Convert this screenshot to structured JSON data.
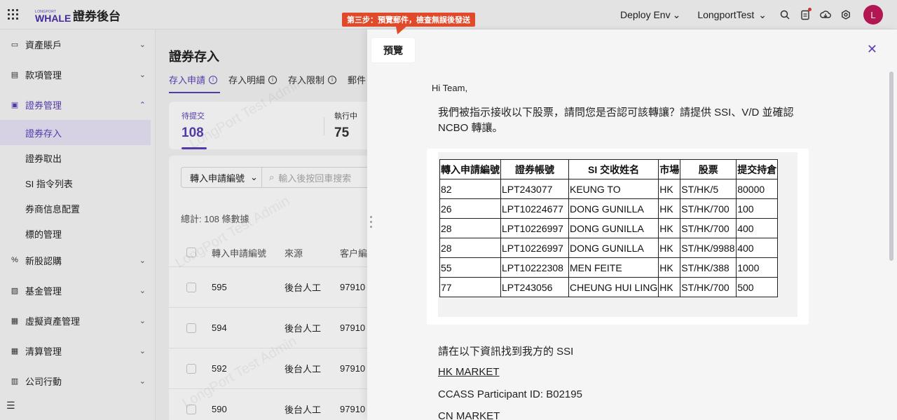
{
  "app": {
    "brand_small": "LONGPORT",
    "brand": "WHALE",
    "title": "證券後台",
    "env_label": "Deploy Env",
    "account_label": "LongportTest",
    "avatar_initial": "L",
    "icons": [
      "apps-grid-icon",
      "search-icon",
      "task-icon",
      "download-icon",
      "settings-icon",
      "chevron-down-icon"
    ]
  },
  "annotation": {
    "text": "第三步：預覽郵件，檢查無誤後發送",
    "color": "#e04a2a"
  },
  "sidebar": {
    "items": [
      {
        "label": "資產賬戶",
        "icon": "wallet-icon"
      },
      {
        "label": "款項管理",
        "icon": "document-icon"
      },
      {
        "label": "證券管理",
        "icon": "chart-icon"
      },
      {
        "label": "新股認購",
        "icon": "ipo-icon"
      },
      {
        "label": "基金管理",
        "icon": "fund-icon"
      },
      {
        "label": "虛擬資產管理",
        "icon": "crypto-icon"
      },
      {
        "label": "清算管理",
        "icon": "clearing-icon"
      },
      {
        "label": "公司行動",
        "icon": "building-icon"
      }
    ],
    "sub_items": [
      "證券存入",
      "證券取出",
      "SI 指令列表",
      "券商信息配置",
      "標的管理"
    ],
    "active_sub": "證券存入",
    "accent": "#5b3fb6"
  },
  "main": {
    "title": "證券存入",
    "tabs": [
      "存入申請",
      "存入明細",
      "存入限制",
      "郵件"
    ],
    "stats": [
      {
        "label": "待提交",
        "value": "108"
      },
      {
        "label": "執行中",
        "value": "75"
      }
    ],
    "filter_select": "轉入申請編號",
    "filter_placeholder": "輸入後按回車搜索",
    "total": "總計:  108 條數據",
    "columns": [
      "轉入申請編號",
      "來源",
      "客户編"
    ],
    "rows": [
      {
        "id": "595",
        "source": "後台人工",
        "client": "97910"
      },
      {
        "id": "594",
        "source": "後台人工",
        "client": "97910"
      },
      {
        "id": "592",
        "source": "後台人工",
        "client": "97910"
      },
      {
        "id": "590",
        "source": "後台人工",
        "client": "97910"
      }
    ]
  },
  "drawer": {
    "title": "預覽",
    "close_icon": "close-icon",
    "greeting": "Hi Team,",
    "intro": "我們被指示接收以下股票，請問您是否認可該轉讓？請提供 SSI、V/D 並確認 NCBO 轉讓。",
    "table": {
      "headers": [
        "轉入申請編號",
        "證券帳號",
        "SI 交收姓名",
        "市場",
        "股票",
        "提交持倉"
      ],
      "rows": [
        [
          "82",
          "LPT243077",
          "KEUNG TO",
          "HK",
          "ST/HK/5",
          "80000"
        ],
        [
          "26",
          "LPT10224677",
          "DONG GUNILLA",
          "HK",
          "ST/HK/700",
          "100"
        ],
        [
          "28",
          "LPT10226997",
          "DONG GUNILLA",
          "HK",
          "ST/HK/700",
          "400"
        ],
        [
          "28",
          "LPT10226997",
          "DONG GUNILLA",
          "HK",
          "ST/HK/9988",
          "400"
        ],
        [
          "55",
          "LPT10222308",
          "MEN FEITE",
          "HK",
          "ST/HK/388",
          "1000"
        ],
        [
          "77",
          "LPT243056",
          "CHEUNG HUI LING",
          "HK",
          "ST/HK/700",
          "500"
        ]
      ]
    },
    "ssi_text": "請在以下資訊找到我方的 SSI",
    "hk_market": "HK MARKET",
    "ccass": "CCASS Participant ID: B02195",
    "cn_market": "CN MARKET"
  },
  "watermark": "LongPort Test Admin"
}
